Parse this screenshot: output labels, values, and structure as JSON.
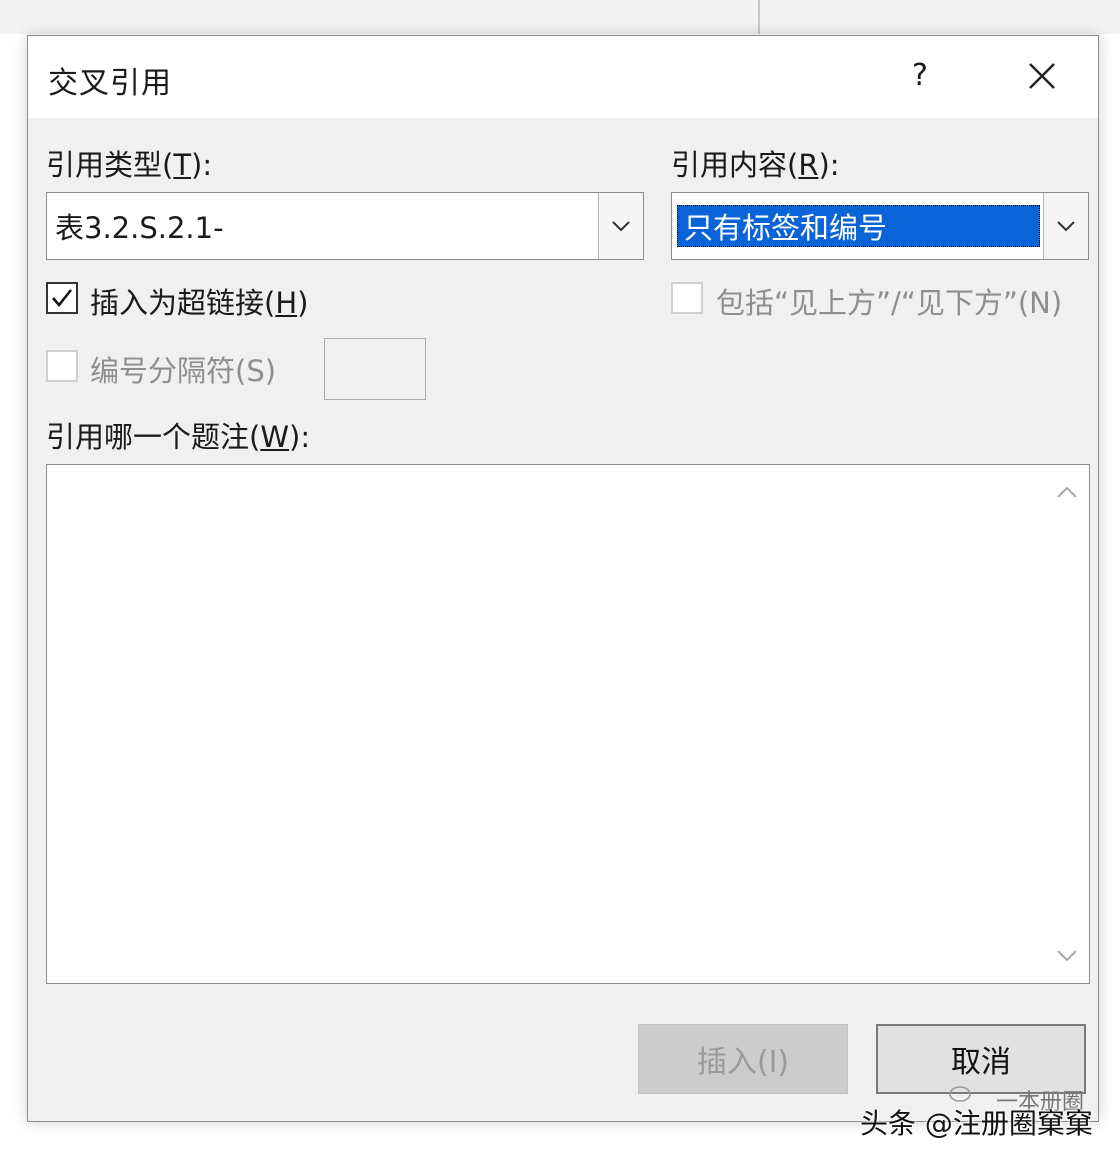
{
  "dialog": {
    "title": "交叉引用",
    "help_label": "?"
  },
  "ref_type": {
    "label_prefix": "引用类型(",
    "label_key": "T",
    "label_suffix": "):",
    "value": "表3.2.S.2.1-"
  },
  "ref_content": {
    "label_prefix": "引用内容(",
    "label_key": "R",
    "label_suffix": "):",
    "value": "只有标签和编号"
  },
  "hyperlink": {
    "label_prefix": "插入为超链接(",
    "label_key": "H",
    "label_suffix": ")",
    "checked": true
  },
  "above_below": {
    "label": "包括“见上方”/“见下方”(N)",
    "checked": false,
    "enabled": false
  },
  "separator": {
    "label": "编号分隔符(S)",
    "checked": false,
    "enabled": false,
    "value": ""
  },
  "caption_list": {
    "label_prefix": "引用哪一个题注(",
    "label_key": "W",
    "label_suffix": "):",
    "items": []
  },
  "buttons": {
    "insert": "插入(I)",
    "cancel": "取消"
  },
  "watermark": {
    "text": "头条 @注册圈窠窠",
    "logo_text": "一本册圈"
  }
}
